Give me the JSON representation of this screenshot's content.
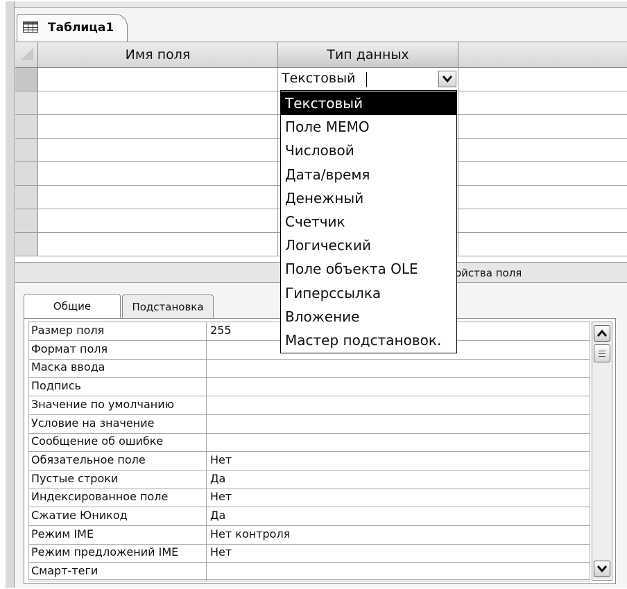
{
  "window": {
    "tab_title": "Таблица1"
  },
  "grid": {
    "columns": [
      "Имя поля",
      "Тип данных"
    ],
    "current_type": "Текстовый",
    "row_count": 8
  },
  "dropdown": {
    "options": [
      "Текстовый",
      "Поле МЕМО",
      "Числовой",
      "Дата/время",
      "Денежный",
      "Счетчик",
      "Логический",
      "Поле объекта OLE",
      "Гиперссылка",
      "Вложение",
      "Мастер подстановок."
    ],
    "selected_index": 0
  },
  "section": {
    "label": "ойства поля"
  },
  "properties": {
    "tabs": [
      "Общие",
      "Подстановка"
    ],
    "active_tab": 0,
    "rows": [
      {
        "name": "Размер поля",
        "value": "255"
      },
      {
        "name": "Формат поля",
        "value": ""
      },
      {
        "name": "Маска ввода",
        "value": ""
      },
      {
        "name": "Подпись",
        "value": ""
      },
      {
        "name": "Значение по умолчанию",
        "value": ""
      },
      {
        "name": "Условие на значение",
        "value": ""
      },
      {
        "name": "Сообщение об ошибке",
        "value": ""
      },
      {
        "name": "Обязательное поле",
        "value": "Нет"
      },
      {
        "name": "Пустые строки",
        "value": "Да"
      },
      {
        "name": "Индексированное поле",
        "value": "Нет"
      },
      {
        "name": "Сжатие Юникод",
        "value": "Да"
      },
      {
        "name": "Режим IME",
        "value": "Нет контроля"
      },
      {
        "name": "Режим предложений IME",
        "value": "Нет"
      },
      {
        "name": "Смарт-теги",
        "value": ""
      }
    ]
  },
  "icons": {
    "tab": "table-icon",
    "combo": "chevron-down-icon",
    "scroll_up": "arrow-up-icon",
    "scroll_down": "arrow-down-icon"
  }
}
